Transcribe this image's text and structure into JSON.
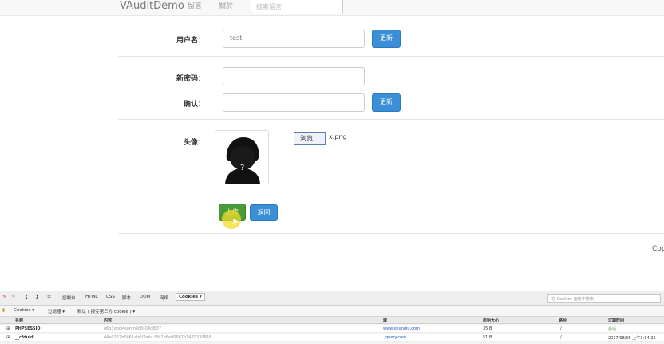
{
  "navbar": {
    "brand": "VAuditDemo",
    "links": [
      "留言",
      "關於"
    ],
    "search_placeholder": "搜索留言"
  },
  "form": {
    "username_label": "用户名：",
    "username_value": "test",
    "update_label": "更新",
    "new_password_label": "新密码：",
    "confirm_label": "确认：",
    "avatar_label": "头像：",
    "browse_label": "浏览...",
    "file_name": "x.png",
    "upload_label": "上传",
    "back_label": "返回"
  },
  "footer": {
    "text": "Cop"
  },
  "devtools": {
    "tabs": [
      "控制台",
      "HTML",
      "CSS",
      "脚本",
      "DOM",
      "网络",
      "Cookies ▾"
    ],
    "search_placeholder": "在 Cookies 面板中搜索",
    "sub_items": [
      "Cookies ▾",
      "过滤器 ▾",
      "默认 ( 接受第三方 cookie ) ▾"
    ],
    "columns": [
      "名称",
      "内容",
      "域",
      "原始大小",
      "路径",
      "过期时间"
    ],
    "rows": [
      {
        "name": "PHPSESSID",
        "content": "o6q3gocj4sonm9c8s04g8i37",
        "domain": "www.xhunqiu.com",
        "size": "35 B",
        "path": "/",
        "expires": "会话"
      },
      {
        "name": "__cfduid",
        "content": "d4e9262b5b61ab6f7eba f3b7b6e90667b1470330848",
        "domain": ".jquery.com",
        "size": "51 B",
        "path": "/",
        "expires": "2017/08/05 上午1:14:26"
      }
    ]
  },
  "colors": {
    "primary": "#3a8fd6",
    "upload": "#4a9a3c",
    "highlight": "#f0dc28"
  }
}
